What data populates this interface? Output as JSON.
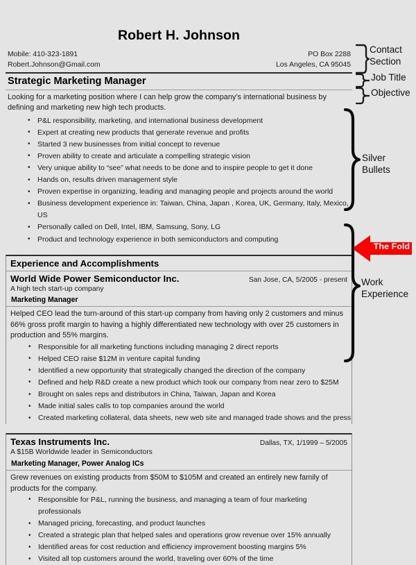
{
  "document": {
    "type": "resume",
    "background_color": "#e4e4e4",
    "rule_color": "#2b2b2b",
    "accent_color": "#ff0000"
  },
  "header": {
    "name": "Robert H. Johnson",
    "contact_left": [
      "Mobile:  410-323-1891",
      "Robert.Johnson@Gmail.com"
    ],
    "contact_right": [
      "PO Box 2288",
      "Los Angeles, CA  95045"
    ]
  },
  "job_title": "Strategic Marketing Manager",
  "objective": "Looking for a marketing position where I can help grow the company’s international business by defining and marketing new high tech products.",
  "silver_bullets": [
    "P&L responsibility, marketing, and international business development",
    "Expert at creating new products that generate revenue and profits",
    "Started 3 new businesses from initial concept to revenue",
    "Proven ability  to create and articulate a compelling strategic vision",
    "Very unique ability to “see” what needs to be done and to inspire people to get it done",
    "Hands on, results driven management style",
    "Proven expertise in organizing, leading and managing people and projects around the world",
    "Business development experience in:  Taiwan, China, Japan , Korea, UK, Germany, Italy, Mexico, US",
    "Personally called on Dell, Intel, IBM, Samsung, Sony, LG",
    "Product and technology experience in both semiconductors and computing"
  ],
  "experience": {
    "heading": "Experience and Accomplishments",
    "jobs": [
      {
        "company": "World Wide Power Semiconductor Inc.",
        "place_date": "San Jose, CA,  5/2005 - present",
        "company_desc": "A high tech start-up company",
        "role": "Marketing Manager",
        "summary": "Helped CEO lead the turn-around of this start-up company from having only 2 customers and minus 66% gross profit margin to having a highly differentiated new technology with over 25 customers in production and 55% margins.",
        "bullets": [
          "Responsible for all marketing functions including managing 2 direct reports",
          "Helped CEO raise $12M in venture capital funding",
          "Identified a new opportunity that strategically changed the direction of the company",
          "Defined and help R&D create a new product which took our company from near zero to $25M",
          "Brought on sales reps and distributors in China, Taiwan, Japan and Korea",
          "Made initial sales calls to top companies around the world",
          "Created marketing collateral, data sheets, new web site and managed trade shows and the press"
        ]
      },
      {
        "company": "Texas Instruments Inc.",
        "place_date": "Dallas, TX,  1/1999 – 5/2005",
        "company_desc": "A $15B Worldwide leader in Semiconductors",
        "role": "Marketing Manager, Power Analog ICs",
        "summary": "Grew revenues on existing products from $50M to $105M and created an entirely new family of products for the company.",
        "bullets": [
          "Responsible for P&L, running the business, and managing a team of four marketing professionals",
          "Managed pricing, forecasting, and product launches",
          "Created a strategic plan that helped sales and operations grow revenue over 15% annually",
          "Identified areas for cost reduction and efficiency improvement boosting margins 5%",
          "Visited all top customers around the world, traveling over 60% of the time"
        ]
      }
    ]
  },
  "annotations": {
    "contact_section": "Contact\nSection",
    "job_title": "Job Title",
    "objective": "Objective",
    "silver_bullets": "Silver Bullets",
    "work_experience": "Work\nExperience",
    "fold": "The Fold"
  }
}
